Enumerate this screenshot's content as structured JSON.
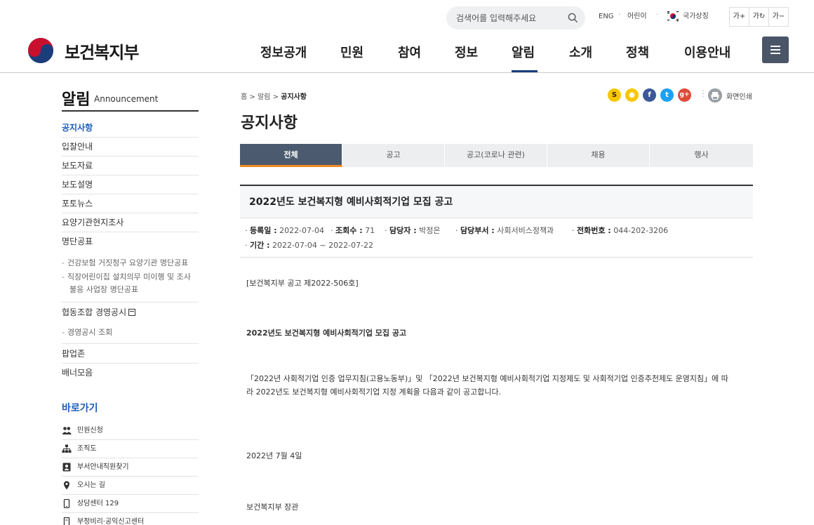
{
  "header": {
    "search_placeholder": "검색어를 입력해주세요",
    "util_eng": "ENG",
    "util_kids": "어린이",
    "util_symbol": "국가상징",
    "font_larger": "가+",
    "font_reset": "가↻",
    "font_smaller": "가−",
    "logo_text": "보건복지부",
    "nav": [
      "정보공개",
      "민원",
      "참여",
      "정보",
      "알림",
      "소개",
      "정책",
      "이용안내"
    ],
    "nav_active": "알림",
    "colors": {
      "brand_blue": "#1c3d7a",
      "accent_orange": "#f08a24",
      "tab_active": "#4b5a6e"
    }
  },
  "sidebar": {
    "title": "알림",
    "title_en": "Announcement",
    "items": [
      "공지사항",
      "입찰안내",
      "보도자료",
      "보도설명",
      "포토뉴스",
      "요양기관현지조사",
      "명단공표"
    ],
    "sub_items_1": [
      "건강보험 거짓청구 요양기관 명단공표",
      "직장어린이집 설치의무 미이행 및 조사",
      "불응 사업장 명단공표"
    ],
    "item_coop": "협동조합 경영공시",
    "sub_items_2": [
      "경영공시 조회"
    ],
    "items_after": [
      "팝업존",
      "배너모음"
    ],
    "quick_title": "바로가기",
    "quick_items": [
      {
        "label": "민원신청",
        "icon": "users-icon"
      },
      {
        "label": "조직도",
        "icon": "org-chart-icon"
      },
      {
        "label": "부서안내직원찾기",
        "icon": "contacts-icon"
      },
      {
        "label": "오시는 길",
        "icon": "location-pin-icon"
      },
      {
        "label": "상담센터 129",
        "icon": "mobile-phone-icon"
      },
      {
        "label": "부정비리·공익신고센터",
        "icon": "report-icon"
      }
    ]
  },
  "content": {
    "breadcrumb": {
      "home": "홈",
      "sep": ">",
      "level1": "알림",
      "current": "공지사항"
    },
    "page_title": "공지사항",
    "share": [
      {
        "name": "kakaostory-icon",
        "glyph": "S",
        "color": "#f6c700"
      },
      {
        "name": "kakaotalk-icon",
        "glyph": "●",
        "color": "#f6c700"
      },
      {
        "name": "facebook-icon",
        "glyph": "f",
        "color": "#3b5998"
      },
      {
        "name": "twitter-icon",
        "glyph": "t",
        "color": "#1da1f2"
      },
      {
        "name": "googleplus-icon",
        "glyph": "g+",
        "color": "#dd4b39"
      }
    ],
    "print_label": "화면인쇄",
    "tabs": [
      "전체",
      "공고",
      "공고(코로나 관련)",
      "채용",
      "행사"
    ],
    "tab_active": "전체",
    "post": {
      "title": "2022년도 보건복지형 예비사회적기업 모집 공고",
      "meta": {
        "reg_label": "등록일 :",
        "reg_value": "2022-07-04",
        "views_label": "조회수 :",
        "views_value": "71",
        "writer_label": "담당자 :",
        "writer_value": "박정은",
        "dept_label": "담당부서 :",
        "dept_value": "사회서비스정책과",
        "phone_label": "전화번호 :",
        "phone_value": "044-202-3206",
        "period_label": "기간 :",
        "period_value": "2022-07-04 ~ 2022-07-22"
      },
      "body": {
        "notice_no": "[보건복지부 공고 제2022-506호]",
        "heading": "2022년도 보건복지형 예비사회적기업 모집 공고",
        "para_line1": "「2022년 사회적기업 인증 업무지침(고용노동부)」및 「2022년 보건복지형 예비사회적기업 지정제도 및 사회적기업 인증추천제도 운영지침」에 따",
        "para_line2": "라 2022년도 보건복지형 예비사회적기업 지정 계획을 다음과 같이 공고합니다.",
        "date": "2022년 7월 4일",
        "signer": "보건복지부 장관"
      }
    }
  }
}
